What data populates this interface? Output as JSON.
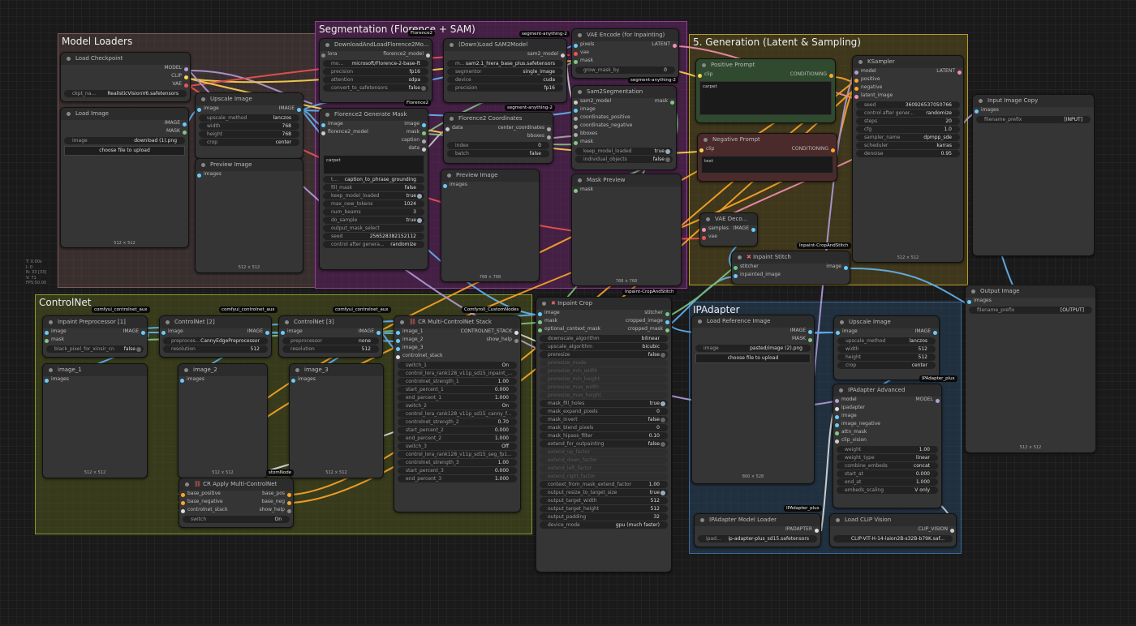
{
  "stats": [
    "T: 0.00s",
    "I: 0",
    "N: 33 [33]",
    "V: 71",
    "FPS:50.00"
  ],
  "groups": {
    "model_loaders": "Model Loaders",
    "segmentation": "Segmentation (Florence + SAM)",
    "generation": "5. Generation (Latent & Sampling)",
    "controlnet": "ControlNet",
    "ipadapter": "IPAdapter"
  },
  "badges": {
    "florence2_a": "Florence2",
    "segment_anything_a": "segment-anything-2",
    "segment_anything_b": "segment-anything-2",
    "florence2_b": "Florence2",
    "segment_anything_c": "segment-anything-2",
    "inpaint_crop_stitch_a": "Inpaint-CropAndStitch",
    "inpaint_crop_stitch_b": "Inpaint-CropAndStitch",
    "cnet_aux_a": "comfyui_controlnet_aux",
    "cnet_aux_b": "comfyui_controlnet_aux",
    "cnet_aux_c": "comfyui_controlnet_aux",
    "custom_nodes": "Comfyroll_CustomNodes",
    "ipadapter_plus_a": "IPAdapter_plus",
    "ipadapter_plus_b": "IPAdapter_plus",
    "custom_nodes_b": "stomNode"
  },
  "load_checkpoint": {
    "title": "Load Checkpoint",
    "out_model": "MODEL",
    "out_clip": "CLIP",
    "out_vae": "VAE",
    "ckpt_key": "ckpt_na...",
    "ckpt_val": "RealisticVisionV6.safetensors"
  },
  "load_image": {
    "title": "Load Image",
    "out_image": "IMAGE",
    "out_mask": "MASK",
    "image_key": "image",
    "image_val": "download (1).png",
    "upload": "choose file to upload",
    "size": "512 × 512"
  },
  "upscale_image": {
    "title": "Upscale Image",
    "in_image": "image",
    "out_image": "IMAGE",
    "method_k": "upscale_method",
    "method_v": "lanczos",
    "width_k": "width",
    "width_v": "768",
    "height_k": "height",
    "height_v": "768",
    "crop_k": "crop",
    "crop_v": "center"
  },
  "preview_image_a": {
    "title": "Preview Image",
    "in_images": "images",
    "size": "512 × 512"
  },
  "download_florence": {
    "title": "DownloadAndLoadFlorence2Mo...",
    "in_lora": "lora",
    "out": "florence2_model",
    "model_k": "mo...",
    "model_v": "microsoft/Florence-2-base-ft",
    "precision_k": "precision",
    "precision_v": "fp16",
    "attention_k": "attention",
    "attention_v": "sdpa",
    "convert_k": "convert_to_safetensors",
    "convert_v": "false"
  },
  "florence_generate": {
    "title": "Florence2 Generate Mask",
    "in_image": "image",
    "in_model": "florence2_model",
    "out_image": "image",
    "out_mask": "mask",
    "out_caption": "caption",
    "out_data": "data",
    "text": "carpet",
    "task_k": "t...",
    "task_v": "caption_to_phrase_grounding",
    "fill_k": "fill_mask",
    "fill_v": "false",
    "keep_k": "keep_model_loaded",
    "keep_v": "true",
    "max_k": "max_new_tokens",
    "max_v": "1024",
    "beams_k": "num_beams",
    "beams_v": "3",
    "sample_k": "do_sample",
    "sample_v": "true",
    "omask_k": "output_mask_select",
    "seed_k": "seed",
    "seed_v": "256528382152112",
    "ctrl_k": "control after genera...",
    "ctrl_v": "randomize"
  },
  "load_sam2": {
    "title": "(Down)Load SAM2Model",
    "out": "sam2_model",
    "model_k": "m...",
    "model_v": "sam2.1_hiera_base_plus.safetensors",
    "segmentor_k": "segmentor",
    "segmentor_v": "single_image",
    "device_k": "device",
    "device_v": "cuda",
    "precision_k": "precision",
    "precision_v": "fp16"
  },
  "florence_coords": {
    "title": "Florence2 Coordinates",
    "in_data": "data",
    "out_cp": "center_coordinates",
    "out_bb": "bboxes",
    "index_k": "index",
    "index_v": "0",
    "batch_k": "batch",
    "batch_v": "false"
  },
  "preview_image_b": {
    "title": "Preview Image",
    "in_images": "images",
    "size": "768 × 768"
  },
  "vae_encode": {
    "title": "VAE Encode (for Inpainting)",
    "in_pixels": "pixels",
    "in_vae": "vae",
    "in_mask": "mask",
    "out": "LATENT",
    "grow_k": "grow_mask_by",
    "grow_v": "0"
  },
  "sam2_seg": {
    "title": "Sam2Segmentation",
    "in_model": "sam2_model",
    "in_image": "image",
    "in_cp": "coordinates_positive",
    "in_cn": "coordinates_negative",
    "in_bb": "bboxes",
    "in_mask": "mask",
    "out_mask": "mask",
    "keep_k": "keep_model_loaded",
    "keep_v": "true",
    "ind_k": "individual_objects",
    "ind_v": "false"
  },
  "mask_preview": {
    "title": "Mask Preview",
    "in_mask": "mask",
    "size": "768 × 768"
  },
  "positive_prompt": {
    "title": "Positive Prompt",
    "in_clip": "clip",
    "out": "CONDITIONING",
    "text": "carpet"
  },
  "negative_prompt": {
    "title": "Negative Prompt",
    "in_clip": "clip",
    "out": "CONDITIONING",
    "text": "text"
  },
  "ksampler": {
    "title": "KSampler",
    "in_model": "model",
    "in_pos": "positive",
    "in_neg": "negative",
    "in_latent": "latent_image",
    "out": "LATENT",
    "seed_k": "seed",
    "seed_v": "360926537050766",
    "ctrl_k": "control after gener...",
    "ctrl_v": "randomize",
    "steps_k": "steps",
    "steps_v": "20",
    "cfg_k": "cfg",
    "cfg_v": "1.0",
    "sampler_k": "sampler_name",
    "sampler_v": "dpmpp_sde",
    "sched_k": "scheduler",
    "sched_v": "karras",
    "denoise_k": "denoise",
    "denoise_v": "0.95",
    "size": "512 × 512"
  },
  "vae_decode": {
    "title": "VAE Deco...",
    "in_samples": "samples",
    "in_vae": "vae",
    "out": "IMAGE"
  },
  "inpaint_stitch": {
    "title": "Inpaint Stitch",
    "in_stitcher": "stitcher",
    "in_inpainted": "inpainted_image",
    "out": "image"
  },
  "input_image_copy": {
    "title": "Input Image Copy",
    "in_images": "images",
    "prefix_k": "filename_prefix",
    "prefix_v": "[INPUT]"
  },
  "output_image": {
    "title": "Output Image",
    "in_images": "images",
    "prefix_k": "filename_prefix",
    "prefix_v": "[OUTPUT]",
    "size": "512 × 512"
  },
  "inpaint_pre": {
    "title": "Inpaint Preprocessor [1]",
    "in_image": "image",
    "in_mask": "mask",
    "out": "IMAGE",
    "w_k": "black_pixel_for_xinsir_cn",
    "w_v": "false"
  },
  "cnet2": {
    "title": "ControlNet [2]",
    "in_image": "image",
    "out": "IMAGE",
    "pre_k": "preproces...",
    "pre_v": "CannyEdgePreprocessor",
    "res_k": "resolution",
    "res_v": "512"
  },
  "cnet3": {
    "title": "ControlNet [3]",
    "in_image": "image",
    "out": "IMAGE",
    "pre_k": "preprocessor",
    "pre_v": "none",
    "res_k": "resolution",
    "res_v": "512"
  },
  "image_1": {
    "title": "image_1",
    "in_images": "images",
    "size": "512 × 512"
  },
  "image_2": {
    "title": "image_2",
    "in_images": "images",
    "size": "512 × 512"
  },
  "image_3": {
    "title": "image_3",
    "in_images": "images",
    "size": "512 × 512"
  },
  "cr_stack": {
    "title": "CR Multi-ControlNet Stack",
    "in_image_1": "image_1",
    "in_image_2": "image_2",
    "in_image_3": "image_3",
    "in_stack": "controlnet_stack",
    "out_stack": "CONTROLNET_STACK",
    "out_help": "show_help",
    "rows": [
      {
        "k": "switch_1",
        "v": "On"
      },
      {
        "k": "control_lora_rank128_v11p_sd15_inpaint_...",
        "v": ""
      },
      {
        "k": "controlnet_strength_1",
        "v": "1.00"
      },
      {
        "k": "start_percent_1",
        "v": "0.000"
      },
      {
        "k": "end_percent_1",
        "v": "1.000"
      },
      {
        "k": "switch_2",
        "v": "On"
      },
      {
        "k": "control_lora_rank128_v11p_sd15_canny_f...",
        "v": ""
      },
      {
        "k": "controlnet_strength_2",
        "v": "0.70"
      },
      {
        "k": "start_percent_2",
        "v": "0.000"
      },
      {
        "k": "end_percent_2",
        "v": "1.000"
      },
      {
        "k": "switch_3",
        "v": "Off"
      },
      {
        "k": "control_lora_rank128_v11p_sd15_seg_fp1...",
        "v": ""
      },
      {
        "k": "controlnet_strength_3",
        "v": "1.00"
      },
      {
        "k": "start_percent_3",
        "v": "0.000"
      },
      {
        "k": "end_percent_3",
        "v": "1.000"
      }
    ]
  },
  "cr_apply": {
    "title": "CR Apply Multi-ControlNet",
    "in_pos": "base_positive",
    "in_neg": "base_negative",
    "in_stack": "controlnet_stack",
    "out_pos": "base_pos",
    "out_neg": "base_neg",
    "out_help": "show_help",
    "switch_k": "switch",
    "switch_v": "On"
  },
  "inpaint_crop": {
    "title": "Inpaint Crop",
    "in_image": "image",
    "in_mask": "mask",
    "in_ocm": "optional_context_mask",
    "out_stitcher": "stitcher",
    "out_cropped_image": "cropped_image",
    "out_cropped_mask": "cropped_mask",
    "rows": [
      {
        "k": "downscale_algorithm",
        "v": "bilinear",
        "d": false
      },
      {
        "k": "upscale_algorithm",
        "v": "bicubic",
        "d": false
      },
      {
        "k": "preresize",
        "v": "false",
        "d": false
      },
      {
        "k": "preresize_mode",
        "v": "",
        "d": true
      },
      {
        "k": "preresize_min_width",
        "v": "",
        "d": true
      },
      {
        "k": "preresize_min_height",
        "v": "",
        "d": true
      },
      {
        "k": "preresize_max_width",
        "v": "",
        "d": true
      },
      {
        "k": "preresize_max_height",
        "v": "",
        "d": true
      },
      {
        "k": "mask_fill_holes",
        "v": "true",
        "d": false
      },
      {
        "k": "mask_expand_pixels",
        "v": "0",
        "d": false
      },
      {
        "k": "mask_invert",
        "v": "false",
        "d": false
      },
      {
        "k": "mask_blend_pixels",
        "v": "0",
        "d": false
      },
      {
        "k": "mask_hipass_filter",
        "v": "0.10",
        "d": false
      },
      {
        "k": "extend_for_outpainting",
        "v": "false",
        "d": false
      },
      {
        "k": "extend_up_factor",
        "v": "",
        "d": true
      },
      {
        "k": "extend_down_factor",
        "v": "",
        "d": true
      },
      {
        "k": "extend_left_factor",
        "v": "",
        "d": true
      },
      {
        "k": "extend_right_factor",
        "v": "",
        "d": true
      },
      {
        "k": "context_from_mask_extend_factor",
        "v": "1.00",
        "d": false
      },
      {
        "k": "output_resize_to_target_size",
        "v": "true",
        "d": false
      },
      {
        "k": "output_target_width",
        "v": "512",
        "d": false
      },
      {
        "k": "output_target_height",
        "v": "512",
        "d": false
      },
      {
        "k": "output_padding",
        "v": "32",
        "d": false
      },
      {
        "k": "device_mode",
        "v": "gpu (much faster)",
        "d": false
      }
    ]
  },
  "load_ref": {
    "title": "Load Reference Image",
    "out_image": "IMAGE",
    "out_mask": "MASK",
    "image_k": "image",
    "image_v": "pasted/image (2).png",
    "upload": "choose file to upload",
    "size": "800 × 528"
  },
  "upscale_image_b": {
    "title": "Upscale Image",
    "in_image": "image",
    "out": "IMAGE",
    "method_k": "upscale_method",
    "method_v": "lanczos",
    "width_k": "width",
    "width_v": "512",
    "height_k": "height",
    "height_v": "512",
    "crop_k": "crop",
    "crop_v": "center"
  },
  "ipadapter_adv": {
    "title": "IPAdapter Advanced",
    "in_model": "model",
    "in_ipadapter": "ipadapter",
    "in_image": "image",
    "in_imgneg": "image_negative",
    "in_attn": "attn_mask",
    "in_clipv": "clip_vision",
    "out": "MODEL",
    "rows": [
      {
        "k": "weight",
        "v": "1.00"
      },
      {
        "k": "weight_type",
        "v": "linear"
      },
      {
        "k": "combine_embeds",
        "v": "concat"
      },
      {
        "k": "start_at",
        "v": "0.000"
      },
      {
        "k": "end_at",
        "v": "1.000"
      },
      {
        "k": "embeds_scaling",
        "v": "V only"
      }
    ]
  },
  "ipadapter_loader": {
    "title": "IPAdapter Model Loader",
    "out": "IPADAPTER",
    "k": "ipad...",
    "v": "ip-adapter-plus_sd15.safetensors"
  },
  "load_clip_vision": {
    "title": "Load CLIP Vision",
    "out": "CLIP_VISION",
    "k": "",
    "v": "CLIP-ViT-H-14-laion2B-s32B-b79K.saf..."
  },
  "colors": {
    "image": "#64b5f6",
    "mask": "#81c784",
    "model": "#b39ddb",
    "clip": "#ffd54f",
    "vae": "#ef5350",
    "conditioning": "#ffa726",
    "latent": "#f48fb1"
  }
}
